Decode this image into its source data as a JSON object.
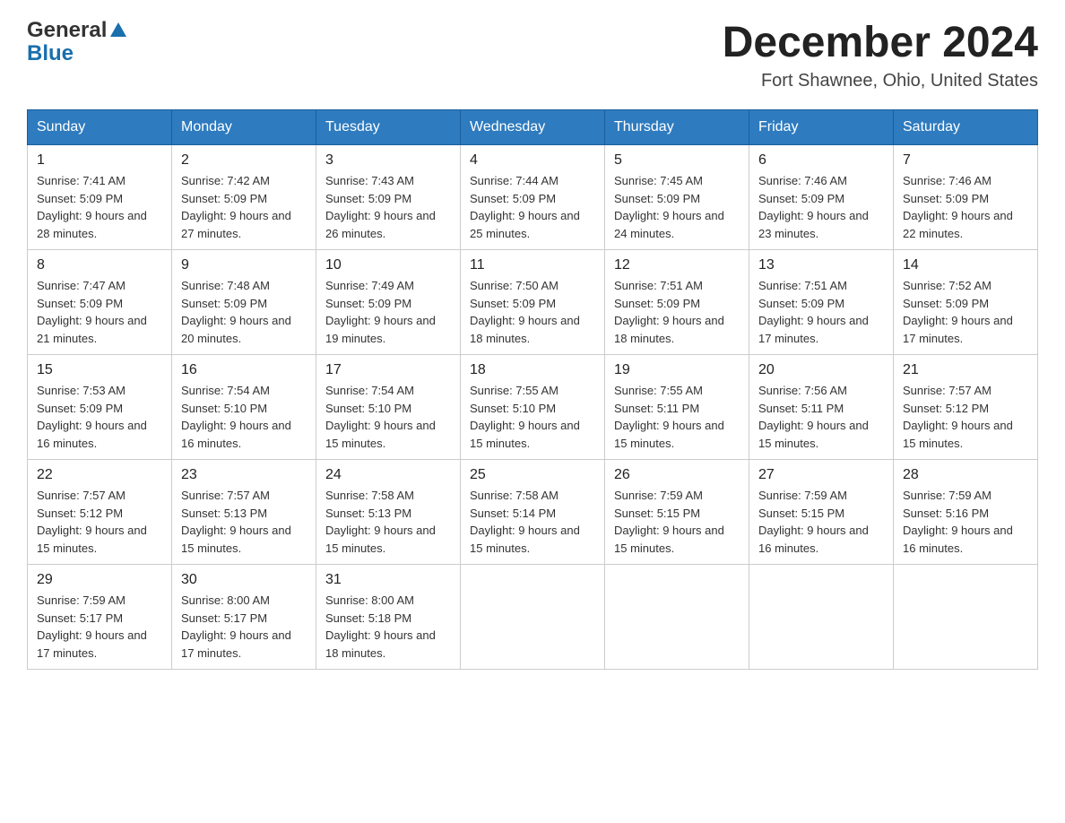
{
  "header": {
    "logo_general": "General",
    "logo_blue": "Blue",
    "month_title": "December 2024",
    "location": "Fort Shawnee, Ohio, United States"
  },
  "days_of_week": [
    "Sunday",
    "Monday",
    "Tuesday",
    "Wednesday",
    "Thursday",
    "Friday",
    "Saturday"
  ],
  "weeks": [
    [
      {
        "day": "1",
        "sunrise": "Sunrise: 7:41 AM",
        "sunset": "Sunset: 5:09 PM",
        "daylight": "Daylight: 9 hours and 28 minutes."
      },
      {
        "day": "2",
        "sunrise": "Sunrise: 7:42 AM",
        "sunset": "Sunset: 5:09 PM",
        "daylight": "Daylight: 9 hours and 27 minutes."
      },
      {
        "day": "3",
        "sunrise": "Sunrise: 7:43 AM",
        "sunset": "Sunset: 5:09 PM",
        "daylight": "Daylight: 9 hours and 26 minutes."
      },
      {
        "day": "4",
        "sunrise": "Sunrise: 7:44 AM",
        "sunset": "Sunset: 5:09 PM",
        "daylight": "Daylight: 9 hours and 25 minutes."
      },
      {
        "day": "5",
        "sunrise": "Sunrise: 7:45 AM",
        "sunset": "Sunset: 5:09 PM",
        "daylight": "Daylight: 9 hours and 24 minutes."
      },
      {
        "day": "6",
        "sunrise": "Sunrise: 7:46 AM",
        "sunset": "Sunset: 5:09 PM",
        "daylight": "Daylight: 9 hours and 23 minutes."
      },
      {
        "day": "7",
        "sunrise": "Sunrise: 7:46 AM",
        "sunset": "Sunset: 5:09 PM",
        "daylight": "Daylight: 9 hours and 22 minutes."
      }
    ],
    [
      {
        "day": "8",
        "sunrise": "Sunrise: 7:47 AM",
        "sunset": "Sunset: 5:09 PM",
        "daylight": "Daylight: 9 hours and 21 minutes."
      },
      {
        "day": "9",
        "sunrise": "Sunrise: 7:48 AM",
        "sunset": "Sunset: 5:09 PM",
        "daylight": "Daylight: 9 hours and 20 minutes."
      },
      {
        "day": "10",
        "sunrise": "Sunrise: 7:49 AM",
        "sunset": "Sunset: 5:09 PM",
        "daylight": "Daylight: 9 hours and 19 minutes."
      },
      {
        "day": "11",
        "sunrise": "Sunrise: 7:50 AM",
        "sunset": "Sunset: 5:09 PM",
        "daylight": "Daylight: 9 hours and 18 minutes."
      },
      {
        "day": "12",
        "sunrise": "Sunrise: 7:51 AM",
        "sunset": "Sunset: 5:09 PM",
        "daylight": "Daylight: 9 hours and 18 minutes."
      },
      {
        "day": "13",
        "sunrise": "Sunrise: 7:51 AM",
        "sunset": "Sunset: 5:09 PM",
        "daylight": "Daylight: 9 hours and 17 minutes."
      },
      {
        "day": "14",
        "sunrise": "Sunrise: 7:52 AM",
        "sunset": "Sunset: 5:09 PM",
        "daylight": "Daylight: 9 hours and 17 minutes."
      }
    ],
    [
      {
        "day": "15",
        "sunrise": "Sunrise: 7:53 AM",
        "sunset": "Sunset: 5:09 PM",
        "daylight": "Daylight: 9 hours and 16 minutes."
      },
      {
        "day": "16",
        "sunrise": "Sunrise: 7:54 AM",
        "sunset": "Sunset: 5:10 PM",
        "daylight": "Daylight: 9 hours and 16 minutes."
      },
      {
        "day": "17",
        "sunrise": "Sunrise: 7:54 AM",
        "sunset": "Sunset: 5:10 PM",
        "daylight": "Daylight: 9 hours and 15 minutes."
      },
      {
        "day": "18",
        "sunrise": "Sunrise: 7:55 AM",
        "sunset": "Sunset: 5:10 PM",
        "daylight": "Daylight: 9 hours and 15 minutes."
      },
      {
        "day": "19",
        "sunrise": "Sunrise: 7:55 AM",
        "sunset": "Sunset: 5:11 PM",
        "daylight": "Daylight: 9 hours and 15 minutes."
      },
      {
        "day": "20",
        "sunrise": "Sunrise: 7:56 AM",
        "sunset": "Sunset: 5:11 PM",
        "daylight": "Daylight: 9 hours and 15 minutes."
      },
      {
        "day": "21",
        "sunrise": "Sunrise: 7:57 AM",
        "sunset": "Sunset: 5:12 PM",
        "daylight": "Daylight: 9 hours and 15 minutes."
      }
    ],
    [
      {
        "day": "22",
        "sunrise": "Sunrise: 7:57 AM",
        "sunset": "Sunset: 5:12 PM",
        "daylight": "Daylight: 9 hours and 15 minutes."
      },
      {
        "day": "23",
        "sunrise": "Sunrise: 7:57 AM",
        "sunset": "Sunset: 5:13 PM",
        "daylight": "Daylight: 9 hours and 15 minutes."
      },
      {
        "day": "24",
        "sunrise": "Sunrise: 7:58 AM",
        "sunset": "Sunset: 5:13 PM",
        "daylight": "Daylight: 9 hours and 15 minutes."
      },
      {
        "day": "25",
        "sunrise": "Sunrise: 7:58 AM",
        "sunset": "Sunset: 5:14 PM",
        "daylight": "Daylight: 9 hours and 15 minutes."
      },
      {
        "day": "26",
        "sunrise": "Sunrise: 7:59 AM",
        "sunset": "Sunset: 5:15 PM",
        "daylight": "Daylight: 9 hours and 15 minutes."
      },
      {
        "day": "27",
        "sunrise": "Sunrise: 7:59 AM",
        "sunset": "Sunset: 5:15 PM",
        "daylight": "Daylight: 9 hours and 16 minutes."
      },
      {
        "day": "28",
        "sunrise": "Sunrise: 7:59 AM",
        "sunset": "Sunset: 5:16 PM",
        "daylight": "Daylight: 9 hours and 16 minutes."
      }
    ],
    [
      {
        "day": "29",
        "sunrise": "Sunrise: 7:59 AM",
        "sunset": "Sunset: 5:17 PM",
        "daylight": "Daylight: 9 hours and 17 minutes."
      },
      {
        "day": "30",
        "sunrise": "Sunrise: 8:00 AM",
        "sunset": "Sunset: 5:17 PM",
        "daylight": "Daylight: 9 hours and 17 minutes."
      },
      {
        "day": "31",
        "sunrise": "Sunrise: 8:00 AM",
        "sunset": "Sunset: 5:18 PM",
        "daylight": "Daylight: 9 hours and 18 minutes."
      },
      null,
      null,
      null,
      null
    ]
  ]
}
